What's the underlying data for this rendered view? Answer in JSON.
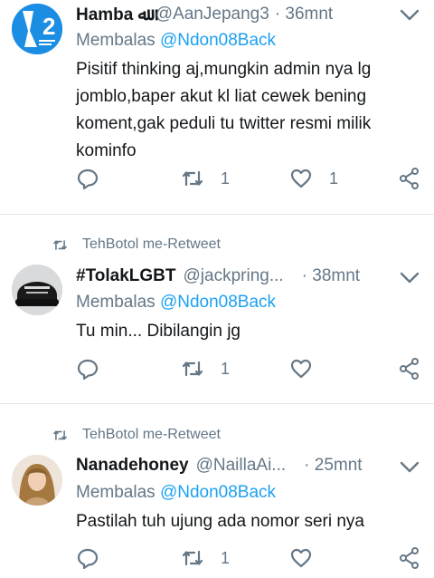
{
  "tweets": [
    {
      "retweeted_by": "",
      "name": "Hamba ﷲ",
      "handle": "@AanJepang3",
      "time": "· 36mnt",
      "reply_prefix": "Membalas",
      "reply_mention": "@Ndon08Back",
      "text_lines": [
        "Pisitif thinking aj,mungkin admin nya lg",
        "jomblo,baper akut kl liat cewek bening",
        "koment,gak peduli tu twitter resmi milik",
        "kominfo"
      ],
      "retweet_count": "1",
      "like_count": "1",
      "avatar_label": "2"
    },
    {
      "retweeted_by": "TehBotol me-Retweet",
      "name": "#TolakLGBT",
      "handle": "@jackpring...",
      "time": "· 38mnt",
      "reply_prefix": "Membalas",
      "reply_mention": "@Ndon08Back",
      "text_lines": [
        "Tu min... Dibilangin jg"
      ],
      "retweet_count": "1",
      "like_count": ""
    },
    {
      "retweeted_by": "TehBotol me-Retweet",
      "name": "Nanadehoney",
      "handle": "@NaillaAi...",
      "time": "· 25mnt",
      "reply_prefix": "Membalas",
      "reply_mention": "@Ndon08Back",
      "text_lines": [
        "Pastilah tuh ujung ada nomor seri nya"
      ],
      "retweet_count": "1",
      "like_count": ""
    }
  ],
  "icons": {
    "reply": "reply-icon",
    "retweet": "retweet-icon",
    "like": "heart-icon",
    "share": "share-icon",
    "caret": "chevron-down-icon"
  },
  "colors": {
    "text": "#14171a",
    "muted": "#657786",
    "link": "#1da1f2",
    "divider": "#e1e8ed"
  }
}
